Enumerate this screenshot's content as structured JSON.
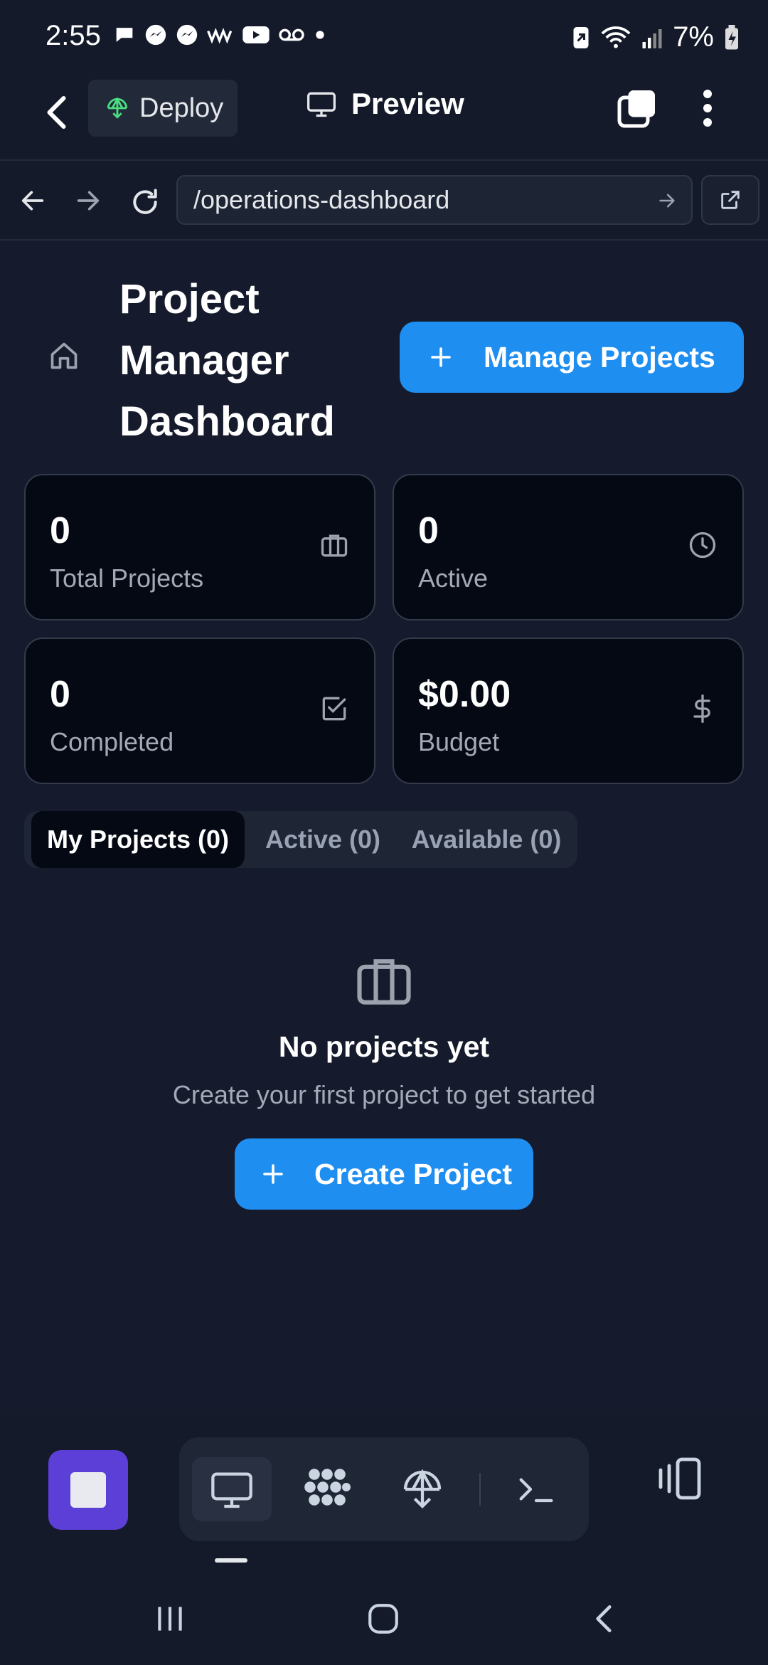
{
  "status_bar": {
    "time": "2:55",
    "battery_percent": "7%"
  },
  "app_bar": {
    "deploy_label": "Deploy",
    "preview_label": "Preview"
  },
  "url_bar": {
    "url": "/operations-dashboard"
  },
  "header": {
    "title": "Project Manager Dashboard",
    "manage_button_label": "Manage Projects"
  },
  "stats": [
    {
      "value": "0",
      "label": "Total Projects",
      "icon": "briefcase-icon"
    },
    {
      "value": "0",
      "label": "Active",
      "icon": "clock-icon"
    },
    {
      "value": "0",
      "label": "Completed",
      "icon": "checkbox-icon"
    },
    {
      "value": "$0.00",
      "label": "Budget",
      "icon": "dollar-icon"
    }
  ],
  "tabs": [
    {
      "label": "My Projects (0)",
      "active": true
    },
    {
      "label": "Active (0)",
      "active": false
    },
    {
      "label": "Available (0)",
      "active": false
    }
  ],
  "empty_state": {
    "title": "No projects yet",
    "subtitle": "Create your first project to get started",
    "button_label": "Create Project"
  },
  "colors": {
    "background": "#151b2c",
    "card": "#050914",
    "accent": "#1f8ef1",
    "stop_button": "#5b3fd6"
  }
}
